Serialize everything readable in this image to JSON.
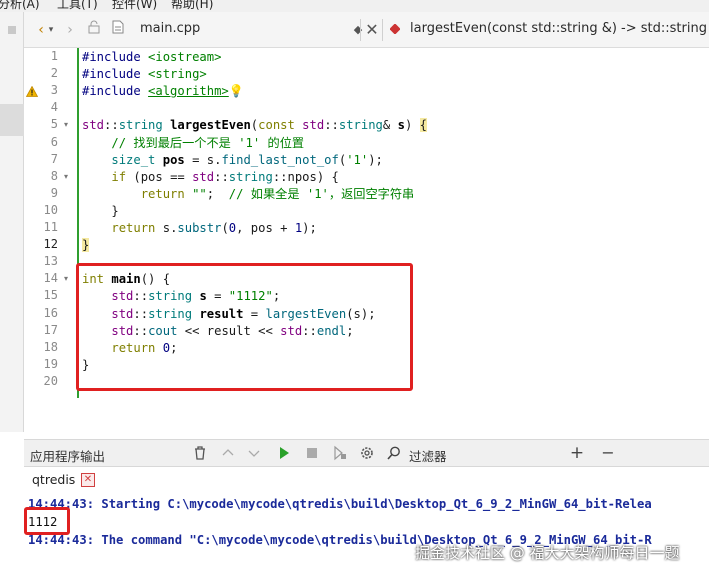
{
  "menu": {
    "items": [
      "分析(A)",
      "工具(T)",
      "控件(W)",
      "帮助(H)"
    ]
  },
  "editor": {
    "file_name": "main.cpp",
    "function_label": "largestEven(const std::string &) -> std::string",
    "current_line": 12,
    "warning_line": 3
  },
  "code_lines": [
    {
      "n": "1",
      "html": "<span class='pp'>#include</span> <span class='st'>&lt;iostream&gt;</span>"
    },
    {
      "n": "2",
      "html": "<span class='pp'>#include</span> <span class='st'>&lt;string&gt;</span>"
    },
    {
      "n": "3",
      "html": "<span class='pp'>#include</span> <span class='st' style='text-decoration:underline'>&lt;algorithm&gt;</span><span style='color:#e0a000'>💡</span>"
    },
    {
      "n": "4",
      "html": ""
    },
    {
      "n": "5",
      "html": "<span class='ns'>std</span>::<span class='ty'>string</span> <span class='vb'>largestEven</span>(<span class='kw'>const</span> <span class='ns'>std</span>::<span class='ty'>string</span>&amp; <span class='vb'>s</span>) <span style='background:#f5e9a0'>{</span>"
    },
    {
      "n": "6",
      "html": "    <span class='cm'>// 找到最后一个不是 '1' 的位置</span>"
    },
    {
      "n": "7",
      "html": "    <span class='ty'>size_t</span> <span class='vb'>pos</span> = s.<span class='fn'>find_last_not_of</span>(<span class='st'>'1'</span>);"
    },
    {
      "n": "8",
      "html": "    <span class='kw'>if</span> (pos == <span class='ns'>std</span>::<span class='ty'>string</span>::npos) {"
    },
    {
      "n": "9",
      "html": "        <span class='kw'>return</span> <span class='st'>\"\"</span>;  <span class='cm'>// 如果全是 '1'，返回空字符串</span>"
    },
    {
      "n": "10",
      "html": "    }"
    },
    {
      "n": "11",
      "html": "    <span class='kw'>return</span> s.<span class='fn'>substr</span>(<span class='nu'>0</span>, pos + <span class='nu'>1</span>);"
    },
    {
      "n": "12",
      "html": "<span style='background:#f5e9a0'>}</span>"
    },
    {
      "n": "13",
      "html": ""
    },
    {
      "n": "14",
      "html": "<span class='kw'>int</span> <span class='vb'>main</span>() {"
    },
    {
      "n": "15",
      "html": "    <span class='ns'>std</span>::<span class='ty'>string</span> <span class='vb'>s</span> = <span class='st'>\"1112\"</span>;"
    },
    {
      "n": "16",
      "html": "    <span class='ns'>std</span>::<span class='ty'>string</span> <span class='vb'>result</span> = <span class='fn'>largestEven</span>(s);"
    },
    {
      "n": "17",
      "html": "    <span class='ns'>std</span>::<span class='fn'>cout</span> &lt;&lt; result &lt;&lt; <span class='ns'>std</span>::<span class='fn'>endl</span>;"
    },
    {
      "n": "18",
      "html": "    <span class='kw'>return</span> <span class='nu'>0</span>;"
    },
    {
      "n": "19",
      "html": "}"
    },
    {
      "n": "20",
      "html": ""
    }
  ],
  "output": {
    "pane_title": "应用程序输出",
    "filter_label": "过滤器",
    "tab_label": "qtredis",
    "lines": [
      {
        "text": "14:44:43: Starting C:\\mycode\\mycode\\qtredis\\build\\Desktop_Qt_6_9_2_MinGW_64_bit-Relea",
        "style": "blue"
      },
      {
        "text": "1112",
        "style": "plain"
      },
      {
        "text": "14:44:43: The command \"C:\\mycode\\mycode\\qtredis\\build\\Desktop_Qt_6_9_2_MinGW_64_bit-R",
        "style": "blue"
      }
    ]
  },
  "watermark": "掘金技术社区 @ 福大大架构师每日一题",
  "colors": {
    "highlight_box": "#e02020",
    "gutter_change": "#2f9e2f",
    "run_green": "#2aa12a"
  }
}
